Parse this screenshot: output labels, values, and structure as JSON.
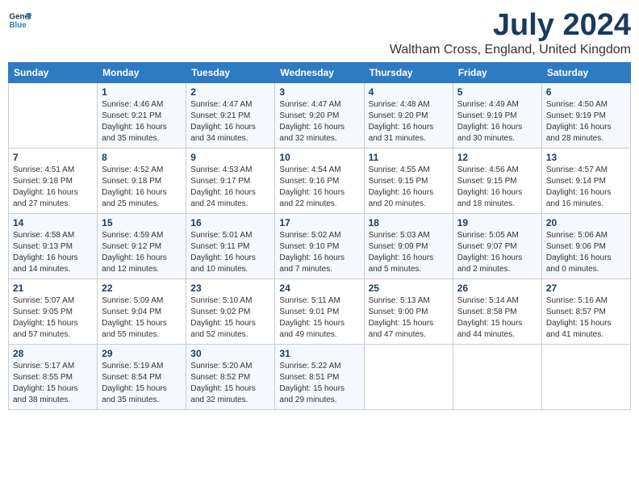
{
  "header": {
    "logo_line1": "General",
    "logo_line2": "Blue",
    "month": "July 2024",
    "location": "Waltham Cross, England, United Kingdom"
  },
  "days_of_week": [
    "Sunday",
    "Monday",
    "Tuesday",
    "Wednesday",
    "Thursday",
    "Friday",
    "Saturday"
  ],
  "weeks": [
    [
      {
        "day": "",
        "info": ""
      },
      {
        "day": "1",
        "info": "Sunrise: 4:46 AM\nSunset: 9:21 PM\nDaylight: 16 hours\nand 35 minutes."
      },
      {
        "day": "2",
        "info": "Sunrise: 4:47 AM\nSunset: 9:21 PM\nDaylight: 16 hours\nand 34 minutes."
      },
      {
        "day": "3",
        "info": "Sunrise: 4:47 AM\nSunset: 9:20 PM\nDaylight: 16 hours\nand 32 minutes."
      },
      {
        "day": "4",
        "info": "Sunrise: 4:48 AM\nSunset: 9:20 PM\nDaylight: 16 hours\nand 31 minutes."
      },
      {
        "day": "5",
        "info": "Sunrise: 4:49 AM\nSunset: 9:19 PM\nDaylight: 16 hours\nand 30 minutes."
      },
      {
        "day": "6",
        "info": "Sunrise: 4:50 AM\nSunset: 9:19 PM\nDaylight: 16 hours\nand 28 minutes."
      }
    ],
    [
      {
        "day": "7",
        "info": "Sunrise: 4:51 AM\nSunset: 9:18 PM\nDaylight: 16 hours\nand 27 minutes."
      },
      {
        "day": "8",
        "info": "Sunrise: 4:52 AM\nSunset: 9:18 PM\nDaylight: 16 hours\nand 25 minutes."
      },
      {
        "day": "9",
        "info": "Sunrise: 4:53 AM\nSunset: 9:17 PM\nDaylight: 16 hours\nand 24 minutes."
      },
      {
        "day": "10",
        "info": "Sunrise: 4:54 AM\nSunset: 9:16 PM\nDaylight: 16 hours\nand 22 minutes."
      },
      {
        "day": "11",
        "info": "Sunrise: 4:55 AM\nSunset: 9:15 PM\nDaylight: 16 hours\nand 20 minutes."
      },
      {
        "day": "12",
        "info": "Sunrise: 4:56 AM\nSunset: 9:15 PM\nDaylight: 16 hours\nand 18 minutes."
      },
      {
        "day": "13",
        "info": "Sunrise: 4:57 AM\nSunset: 9:14 PM\nDaylight: 16 hours\nand 16 minutes."
      }
    ],
    [
      {
        "day": "14",
        "info": "Sunrise: 4:58 AM\nSunset: 9:13 PM\nDaylight: 16 hours\nand 14 minutes."
      },
      {
        "day": "15",
        "info": "Sunrise: 4:59 AM\nSunset: 9:12 PM\nDaylight: 16 hours\nand 12 minutes."
      },
      {
        "day": "16",
        "info": "Sunrise: 5:01 AM\nSunset: 9:11 PM\nDaylight: 16 hours\nand 10 minutes."
      },
      {
        "day": "17",
        "info": "Sunrise: 5:02 AM\nSunset: 9:10 PM\nDaylight: 16 hours\nand 7 minutes."
      },
      {
        "day": "18",
        "info": "Sunrise: 5:03 AM\nSunset: 9:09 PM\nDaylight: 16 hours\nand 5 minutes."
      },
      {
        "day": "19",
        "info": "Sunrise: 5:05 AM\nSunset: 9:07 PM\nDaylight: 16 hours\nand 2 minutes."
      },
      {
        "day": "20",
        "info": "Sunrise: 5:06 AM\nSunset: 9:06 PM\nDaylight: 16 hours\nand 0 minutes."
      }
    ],
    [
      {
        "day": "21",
        "info": "Sunrise: 5:07 AM\nSunset: 9:05 PM\nDaylight: 15 hours\nand 57 minutes."
      },
      {
        "day": "22",
        "info": "Sunrise: 5:09 AM\nSunset: 9:04 PM\nDaylight: 15 hours\nand 55 minutes."
      },
      {
        "day": "23",
        "info": "Sunrise: 5:10 AM\nSunset: 9:02 PM\nDaylight: 15 hours\nand 52 minutes."
      },
      {
        "day": "24",
        "info": "Sunrise: 5:11 AM\nSunset: 9:01 PM\nDaylight: 15 hours\nand 49 minutes."
      },
      {
        "day": "25",
        "info": "Sunrise: 5:13 AM\nSunset: 9:00 PM\nDaylight: 15 hours\nand 47 minutes."
      },
      {
        "day": "26",
        "info": "Sunrise: 5:14 AM\nSunset: 8:58 PM\nDaylight: 15 hours\nand 44 minutes."
      },
      {
        "day": "27",
        "info": "Sunrise: 5:16 AM\nSunset: 8:57 PM\nDaylight: 15 hours\nand 41 minutes."
      }
    ],
    [
      {
        "day": "28",
        "info": "Sunrise: 5:17 AM\nSunset: 8:55 PM\nDaylight: 15 hours\nand 38 minutes."
      },
      {
        "day": "29",
        "info": "Sunrise: 5:19 AM\nSunset: 8:54 PM\nDaylight: 15 hours\nand 35 minutes."
      },
      {
        "day": "30",
        "info": "Sunrise: 5:20 AM\nSunset: 8:52 PM\nDaylight: 15 hours\nand 32 minutes."
      },
      {
        "day": "31",
        "info": "Sunrise: 5:22 AM\nSunset: 8:51 PM\nDaylight: 15 hours\nand 29 minutes."
      },
      {
        "day": "",
        "info": ""
      },
      {
        "day": "",
        "info": ""
      },
      {
        "day": "",
        "info": ""
      }
    ]
  ]
}
